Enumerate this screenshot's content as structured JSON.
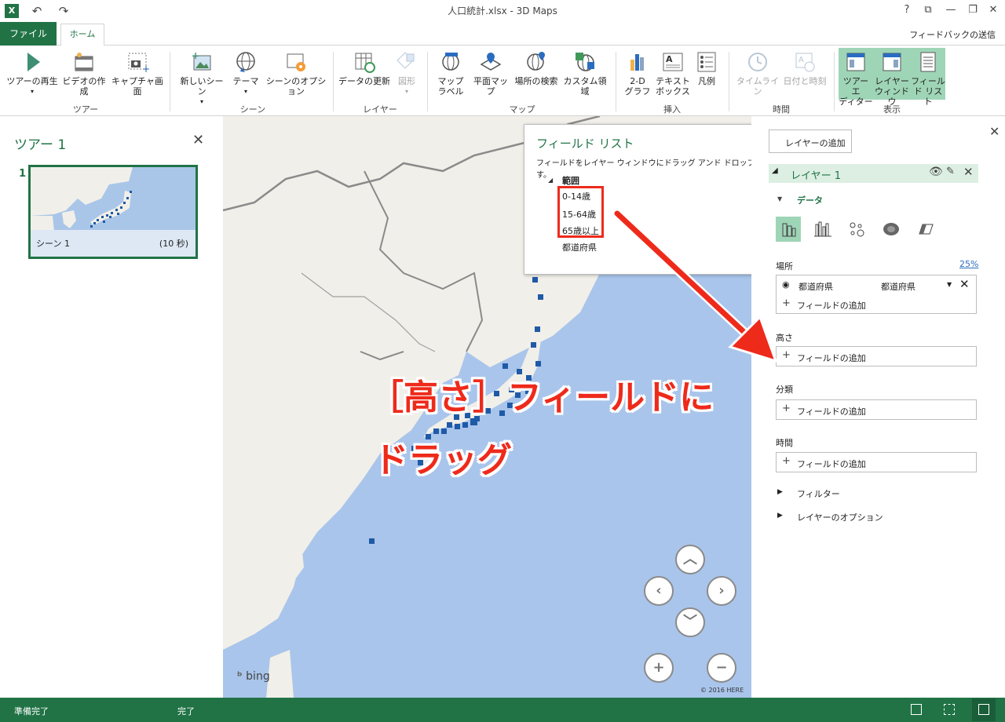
{
  "window": {
    "title": "人口統計.xlsx - 3D Maps",
    "help": "?",
    "app_icon": "excel-logo"
  },
  "tabs": {
    "file": "ファイル",
    "home": "ホーム",
    "feedback": "フィードバックの送信"
  },
  "ribbon": {
    "groups": {
      "tour": "ツアー",
      "scene": "シーン",
      "layer": "レイヤー",
      "map": "マップ",
      "insert": "挿入",
      "time": "時間",
      "view": "表示"
    },
    "buttons": {
      "play_tour": "ツアーの再生",
      "create_video": "ビデオの作成",
      "capture_screen": "キャプチャ画面",
      "new_scene": "新しいシーン",
      "theme": "テーマ",
      "scene_options": "シーンのオプション",
      "refresh_data": "データの更新",
      "shapes": "図形",
      "map_labels_1": "マップ",
      "map_labels_2": "ラベル",
      "flat_map": "平面マップ",
      "find_location": "場所の検索",
      "custom_regions": "カスタム領域",
      "graph_2d_1": "2-D",
      "graph_2d_2": "グラフ",
      "text_box_1": "テキスト",
      "text_box_2": "ボックス",
      "legend": "凡例",
      "timeline": "タイムライン",
      "date_time": "日付と時刻",
      "tour_editor_1": "ツアー エ",
      "tour_editor_2": "ディター",
      "layer_window_1": "レイヤー",
      "layer_window_2": "ウィンドウ",
      "field_list_1": "フィール",
      "field_list_2": "ド リスト"
    }
  },
  "tour_pane": {
    "title": "ツアー 1",
    "scene_number": "1",
    "scene_name": "シーン 1",
    "scene_duration": "(10 秒)"
  },
  "map": {
    "brand": "bing",
    "copyright": "© 2016 HERE"
  },
  "field_list": {
    "title": "フィールド リスト",
    "instruction": "フィールドをレイヤー ウィンドウにドラッグ アンド ドロップします。",
    "table": "範囲",
    "fields": [
      "0-14歳",
      "15-64歳",
      "65歳以上",
      "都道府県"
    ]
  },
  "layer_pane": {
    "add_layer": "レイヤーの追加",
    "layer_name": "レイヤー 1",
    "data_section": "データ",
    "location_label": "場所",
    "location_percent": "25%",
    "location_field": "都道府県",
    "location_type": "都道府県",
    "add_field": "フィールドの追加",
    "height_label": "高さ",
    "category_label": "分類",
    "time_label": "時間",
    "filter": "フィルター",
    "layer_options": "レイヤーのオプション"
  },
  "status_bar": {
    "ready": "準備完了",
    "done": "完了"
  },
  "annotation": {
    "line1": "［高さ］フィールドに",
    "line2": "ドラッグ"
  },
  "colors": {
    "excel_green": "#217346",
    "annotation_red": "#ee2a1b",
    "ocean": "#a9c5eb",
    "land": "#f1efe9",
    "data_point": "#1f5aa6",
    "highlight": "#9fd5b7"
  }
}
